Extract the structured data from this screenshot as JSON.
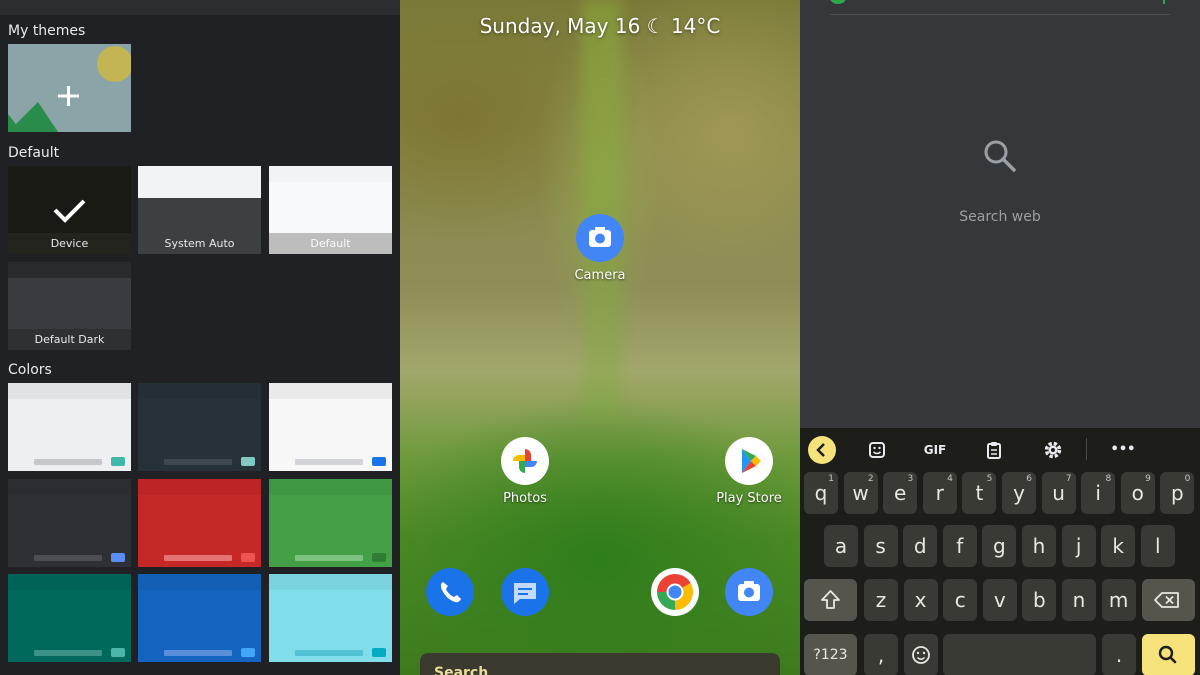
{
  "left_panel": {
    "my_themes_title": "My themes",
    "add_icon": "plus-icon",
    "default_title": "Default",
    "default_themes": [
      {
        "label": "Device",
        "selected": true
      },
      {
        "label": "System Auto"
      },
      {
        "label": "Default"
      },
      {
        "label": "Default Dark"
      }
    ],
    "colors_title": "Colors",
    "color_themes": [
      {
        "bg": "#eeeff1",
        "bar": "#c6c7cb",
        "accent": "#3fb8a7"
      },
      {
        "bg": "#263238",
        "bar": "#3f4a4f",
        "accent": "#7fcbc4"
      },
      {
        "bg": "#f7f7f8",
        "bar": "#d3d4d7",
        "accent": "#1a73e8"
      },
      {
        "bg": "#2e3035",
        "bar": "#4c4e53",
        "accent": "#5b8ef1"
      },
      {
        "bg": "#c62828",
        "bar": "#e57373",
        "accent": "#ef5350"
      },
      {
        "bg": "#43a047",
        "bar": "#7dc380",
        "accent": "#2e7d32"
      },
      {
        "bg": "#00695c",
        "bar": "#3d9187",
        "accent": "#4db6ac"
      },
      {
        "bg": "#1565c0",
        "bar": "#5c8fdb",
        "accent": "#42a5f5"
      },
      {
        "bg": "#80deea",
        "bar": "#53c2d3",
        "accent": "#00acc1"
      }
    ]
  },
  "home_screen": {
    "date_weather": "Sunday, May 16 ☾ 14°C",
    "apps": [
      {
        "label": "Camera",
        "icon": "camera-icon"
      },
      {
        "label": "Photos",
        "icon": "photos-pinwheel-icon"
      },
      {
        "label": "Play Store",
        "icon": "play-store-icon"
      }
    ],
    "dock": [
      {
        "icon": "phone-icon"
      },
      {
        "icon": "messages-icon"
      },
      {
        "icon": "chrome-icon"
      },
      {
        "icon": "camera-icon"
      }
    ],
    "search_label": "Search"
  },
  "keyboard_screen": {
    "search_web_label": "Search web",
    "toolbar": [
      {
        "icon": "back-chevron-icon"
      },
      {
        "icon": "sticker-icon"
      },
      {
        "label": "GIF"
      },
      {
        "icon": "clipboard-icon"
      },
      {
        "icon": "settings-gear-icon"
      },
      {
        "label": "•••"
      }
    ],
    "row1": [
      {
        "key": "q",
        "hint": "1"
      },
      {
        "key": "w",
        "hint": "2"
      },
      {
        "key": "e",
        "hint": "3"
      },
      {
        "key": "r",
        "hint": "4"
      },
      {
        "key": "t",
        "hint": "5"
      },
      {
        "key": "y",
        "hint": "6"
      },
      {
        "key": "u",
        "hint": "7"
      },
      {
        "key": "i",
        "hint": "8"
      },
      {
        "key": "o",
        "hint": "9"
      },
      {
        "key": "p",
        "hint": "0"
      }
    ],
    "row2": [
      "a",
      "s",
      "d",
      "f",
      "g",
      "h",
      "j",
      "k",
      "l"
    ],
    "row3": [
      "z",
      "x",
      "c",
      "v",
      "b",
      "n",
      "m"
    ],
    "symbols_key": "?123",
    "comma_key": ",",
    "period_key": ".",
    "accent": "#f6e27a"
  }
}
